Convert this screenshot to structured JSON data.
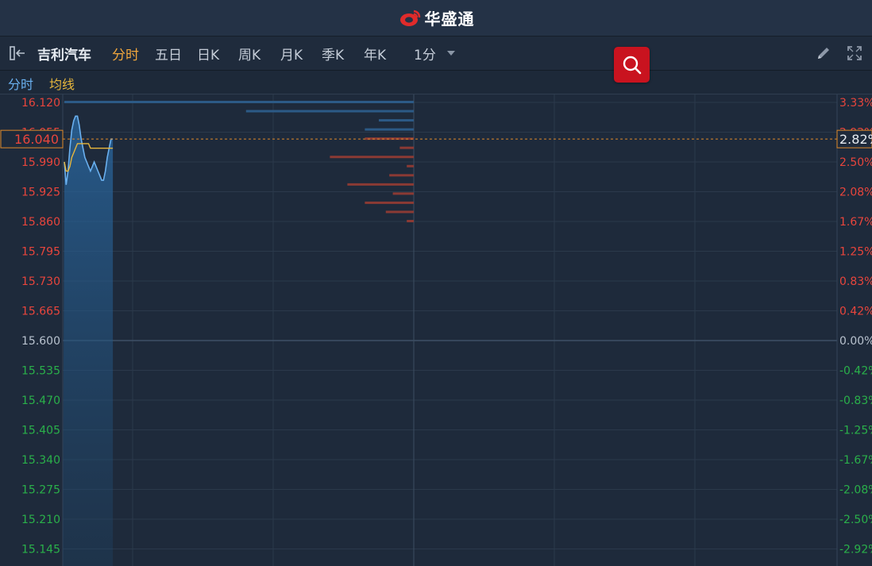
{
  "header": {
    "brand": "华盛通"
  },
  "toolbar": {
    "symbol": "吉利汽车",
    "tabs": [
      {
        "label": "分时",
        "active": true
      },
      {
        "label": "五日",
        "active": false
      },
      {
        "label": "日K",
        "active": false
      },
      {
        "label": "周K",
        "active": false
      },
      {
        "label": "月K",
        "active": false
      },
      {
        "label": "季K",
        "active": false
      },
      {
        "label": "年K",
        "active": false
      },
      {
        "label": "1分",
        "active": false
      }
    ]
  },
  "legend": {
    "series_main": "分时",
    "series_avg": "均线"
  },
  "colors": {
    "up": "#e8453c",
    "down": "#2ab04a",
    "neutral": "#b8c2ce",
    "price_line": "#6ab0ef",
    "avg_line": "#e6b63d",
    "active_tab": "#f0a63c",
    "search_button": "#c9131f"
  },
  "icons": {
    "panel_toggle": "panel-collapse-icon",
    "search": "search-icon",
    "edit": "pencil-icon",
    "fullscreen": "fullscreen-icon"
  },
  "chart_data": {
    "type": "line",
    "y_left_ticks": [
      "16.120",
      "16.055",
      "15.990",
      "15.925",
      "15.860",
      "15.795",
      "15.730",
      "15.665",
      "15.600",
      "15.535",
      "15.470",
      "15.405",
      "15.340",
      "15.275",
      "15.210",
      "15.145"
    ],
    "y_right_ticks": [
      "3.33%",
      "2.92%",
      "2.50%",
      "2.08%",
      "1.67%",
      "1.25%",
      "0.83%",
      "0.42%",
      "0.00%",
      "-0.42%",
      "-0.83%",
      "-1.25%",
      "-1.67%",
      "-2.08%",
      "-2.50%",
      "-2.92%"
    ],
    "prev_close": 15.6,
    "ylim": [
      15.12,
      16.13
    ],
    "current_price": "16.040",
    "current_change": "2.82%",
    "series": [
      {
        "name": "分时",
        "values": [
          15.99,
          15.94,
          15.97,
          16.02,
          16.06,
          16.08,
          16.09,
          16.09,
          16.07,
          16.04,
          16.02,
          16.0,
          15.99,
          15.98,
          15.97,
          15.98,
          15.99,
          15.98,
          15.97,
          15.96,
          15.95,
          15.95,
          15.97,
          16.0,
          16.02,
          16.04,
          16.04
        ]
      },
      {
        "name": "均线",
        "values": [
          15.99,
          15.97,
          15.97,
          15.98,
          16.0,
          16.01,
          16.02,
          16.03,
          16.03,
          16.03,
          16.03,
          16.03,
          16.03,
          16.03,
          16.02,
          16.02,
          16.02,
          16.02,
          16.02,
          16.02,
          16.02,
          16.02,
          16.02,
          16.02,
          16.02,
          16.02,
          16.02
        ]
      }
    ],
    "order_book": {
      "ask": [
        {
          "price": 16.12,
          "volume": 100
        },
        {
          "price": 16.1,
          "volume": 48
        },
        {
          "price": 16.08,
          "volume": 10
        },
        {
          "price": 16.06,
          "volume": 14
        }
      ],
      "bid": [
        {
          "price": 16.04,
          "volume": 14
        },
        {
          "price": 16.02,
          "volume": 4
        },
        {
          "price": 16.0,
          "volume": 24
        },
        {
          "price": 15.98,
          "volume": 2
        },
        {
          "price": 15.96,
          "volume": 7
        },
        {
          "price": 15.94,
          "volume": 19
        },
        {
          "price": 15.92,
          "volume": 6
        },
        {
          "price": 15.9,
          "volume": 14
        },
        {
          "price": 15.88,
          "volume": 8
        },
        {
          "price": 15.86,
          "volume": 2
        }
      ]
    }
  }
}
